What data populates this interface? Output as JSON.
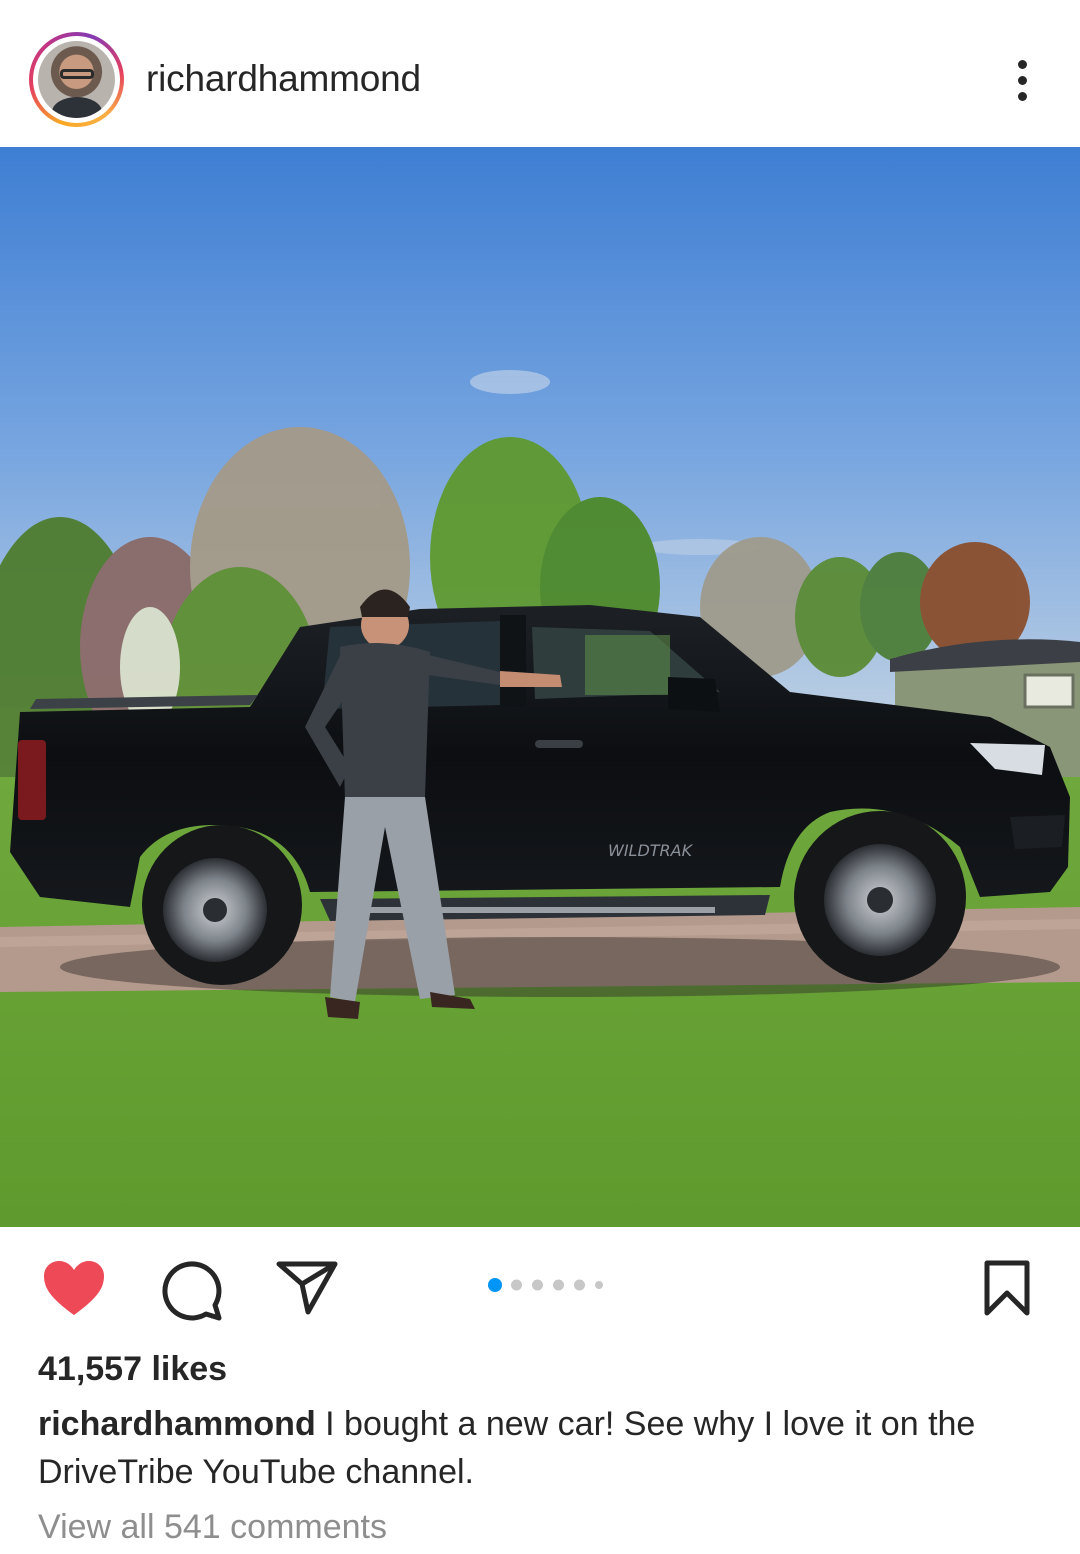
{
  "post": {
    "username": "richardhammond",
    "likes_text": "41,557 likes",
    "caption_user": "richardhammond",
    "caption_text": " I bought a new car! See why I love it on the DriveTribe YouTube channel.",
    "view_comments": "View all 541 comments",
    "liked": true,
    "carousel": {
      "count": 6,
      "active_index": 0
    },
    "photo_alt": "Man in grey top and jeans pointing at a black pickup truck parked on a gravel path beside a lawn, trees and a hut behind",
    "vehicle_badge": "WILDTRAK"
  },
  "icons": {
    "more": "more-vertical-icon",
    "like": "heart-icon",
    "comment": "comment-icon",
    "share": "send-icon",
    "save": "bookmark-icon"
  },
  "colors": {
    "like_red": "#ed4956",
    "carousel_active": "#0095f6",
    "carousel_inactive": "#c7c7c7",
    "text": "#262626",
    "muted": "#8e8e8e"
  }
}
